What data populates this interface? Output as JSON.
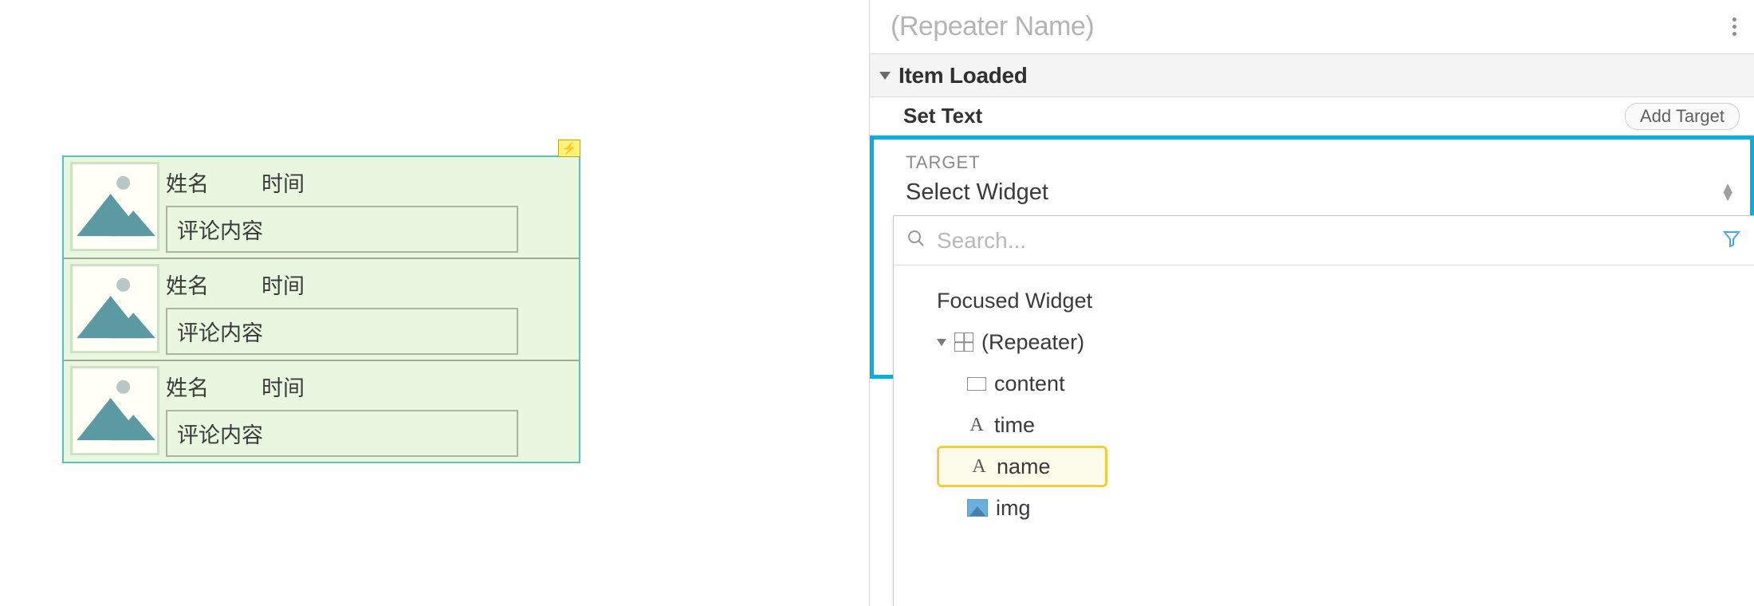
{
  "canvas": {
    "rows": [
      {
        "name": "姓名",
        "time": "时间",
        "content": "评论内容"
      },
      {
        "name": "姓名",
        "time": "时间",
        "content": "评论内容"
      },
      {
        "name": "姓名",
        "time": "时间",
        "content": "评论内容"
      }
    ]
  },
  "panel": {
    "title_placeholder": "(Repeater Name)",
    "section": "Item Loaded",
    "action_label": "Set Text",
    "add_target": "Add Target",
    "target_label": "TARGET",
    "select_widget": "Select Widget"
  },
  "dropdown": {
    "search_placeholder": "Search...",
    "focused": "Focused Widget",
    "repeater": "(Repeater)",
    "items": {
      "content": "content",
      "time": "time",
      "name": "name",
      "img": "img"
    }
  }
}
